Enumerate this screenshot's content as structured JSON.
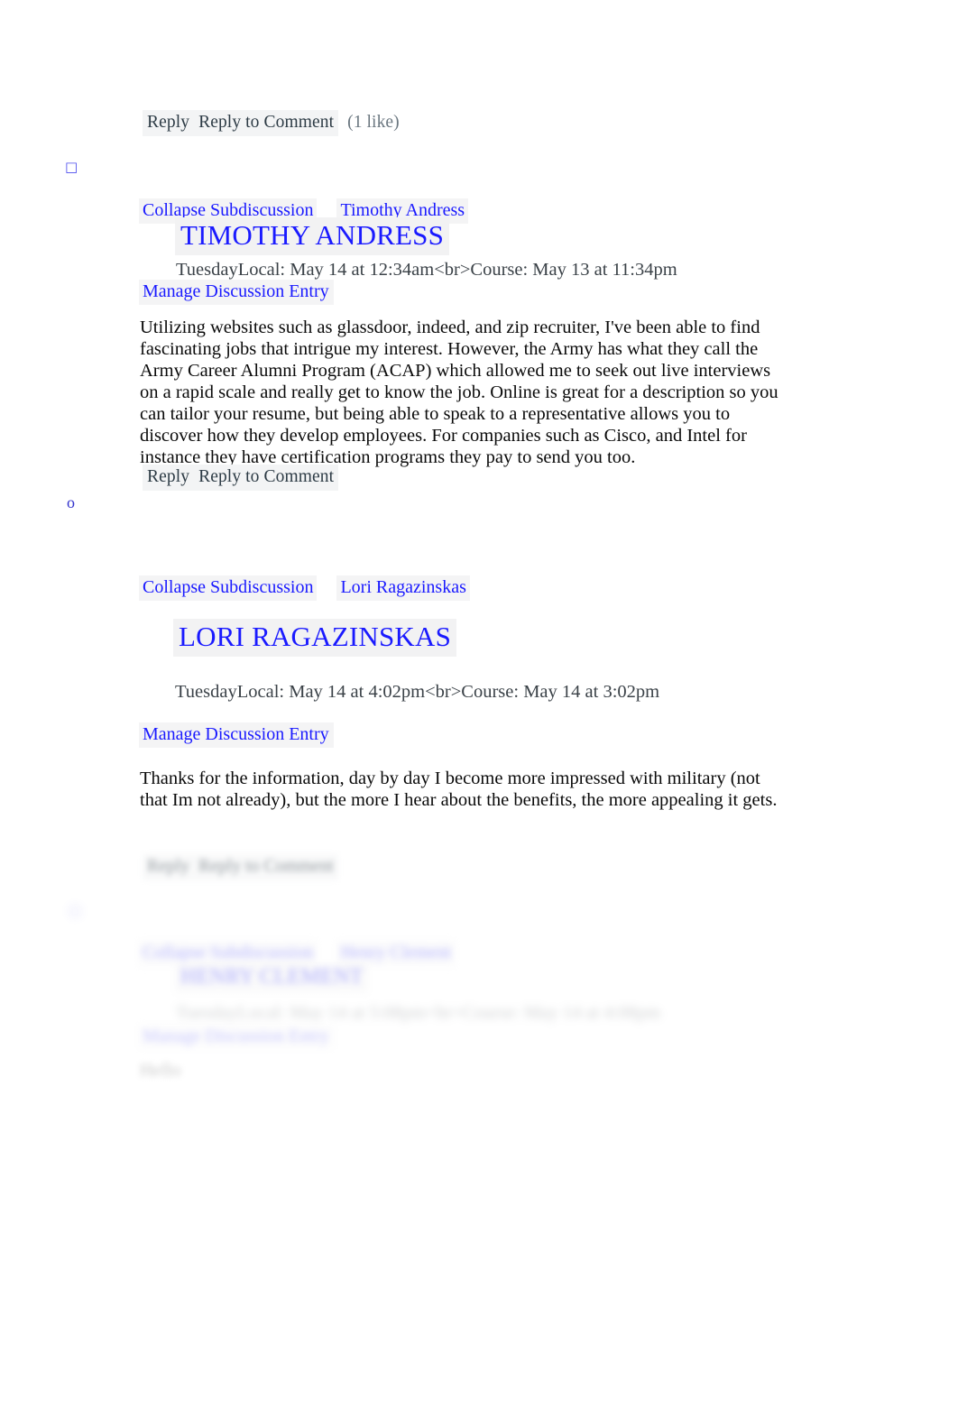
{
  "document": {
    "type": "canvas-discussion-thread-export",
    "background_color": "#ffffff",
    "link_color": "#1a1aff",
    "action_text_color": "#2d3b45",
    "highlight_color": "#f4f4f5"
  },
  "top_action_bar": {
    "reply_label": "Reply",
    "reply_to_comment_label": "Reply to Comment",
    "likes_label": "(1 like)"
  },
  "markers": {
    "tofu_glyph": "□",
    "circle_o_glyph": "o",
    "faded_glyph": "□"
  },
  "entries": [
    {
      "collapse_label": "Collapse Subdiscussion",
      "author_link": "Timothy Andress",
      "author_heading": "TIMOTHY ANDRESS",
      "timestamp": "TuesdayLocal: May 14 at 12:34am<br>Course: May 13 at 11:34pm",
      "manage_label": "Manage Discussion Entry",
      "body": "Utilizing websites such as glassdoor, indeed, and zip recruiter, I've been able to find fascinating jobs that intrigue my interest. However, the Army has what they call the Army Career Alumni Program (ACAP) which allowed me to seek out live interviews on a rapid scale and really get to know the job. Online is great for a description so you can tailor your resume, but being able to speak to a representative allows you to discover how they develop employees. For companies such as Cisco, and Intel for instance they have certification programs they pay to send you too.",
      "reply_label": "Reply",
      "reply_to_comment_label": "Reply to Comment"
    },
    {
      "collapse_label": "Collapse Subdiscussion",
      "author_link": "Lori Ragazinskas",
      "author_heading": "LORI RAGAZINSKAS",
      "timestamp": "TuesdayLocal: May 14 at 4:02pm<br>Course: May 14 at 3:02pm",
      "manage_label": "Manage Discussion Entry",
      "body": "Thanks for the information, day by day I become more impressed with military (not that Im not already), but the more I hear about the benefits, the more appealing it gets.",
      "reply_label": "Reply",
      "reply_to_comment_label": "Reply to Comment"
    },
    {
      "collapse_label": "Collapse Subdiscussion",
      "author_link": "Henry Clement",
      "author_heading": "HENRY CLEMENT",
      "timestamp": "TuesdayLocal: May 14 at 5:08pm<br>Course: May 14 at 4:08pm",
      "manage_label": "Manage Discussion Entry",
      "body": "Hello",
      "reply_label": "Reply",
      "reply_to_comment_label": "Reply to Comment"
    }
  ]
}
